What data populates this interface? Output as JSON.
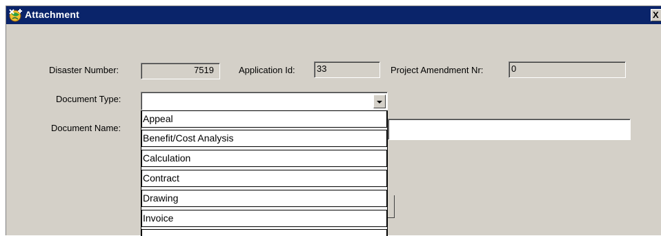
{
  "window": {
    "title": "Attachment",
    "close_label": "X"
  },
  "form": {
    "disaster_number": {
      "label": "Disaster Number:",
      "value": "7519"
    },
    "application_id": {
      "label": "Application Id:",
      "value": "33"
    },
    "project_amendment": {
      "label": "Project Amendment Nr:",
      "value": "0"
    },
    "document_type": {
      "label": "Document Type:",
      "value": ""
    },
    "document_name": {
      "label": "Document Name:",
      "value": ""
    }
  },
  "dropdown": {
    "options": [
      "Appeal",
      "Benefit/Cost Analysis",
      "Calculation",
      "Contract",
      "Drawing",
      "Invoice",
      ""
    ]
  },
  "colors": {
    "titlebar": "#0a246a",
    "dialog_bg": "#d4d0c8",
    "field_white": "#ffffff"
  },
  "icons": {
    "app": "globe-plus-icon",
    "dropdown": "chevron-down-icon"
  }
}
